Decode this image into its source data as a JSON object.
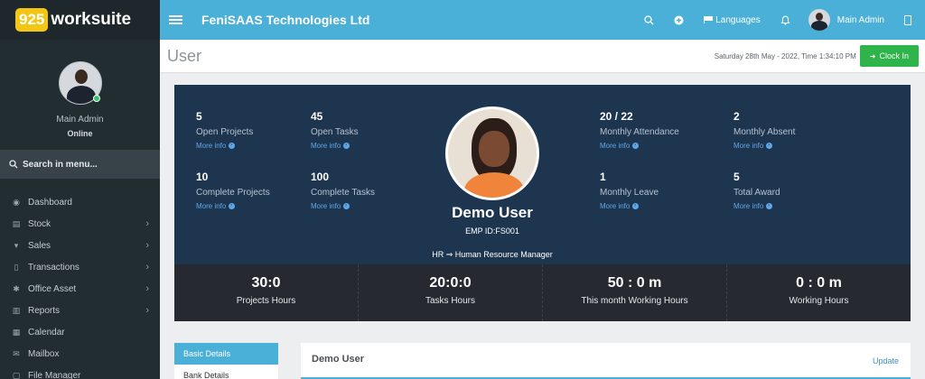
{
  "brand": {
    "badge": "925",
    "name": "worksuite"
  },
  "sidebar": {
    "profile_name": "Main Admin",
    "profile_status": "Online",
    "search_label": "Search in menu...",
    "items": [
      {
        "icon": "dashboard-icon",
        "label": "Dashboard",
        "chevron": false
      },
      {
        "icon": "stock-icon",
        "label": "Stock",
        "chevron": true
      },
      {
        "icon": "cart-icon",
        "label": "Sales",
        "chevron": true
      },
      {
        "icon": "transactions-icon",
        "label": "Transactions",
        "chevron": true
      },
      {
        "icon": "office-asset-icon",
        "label": "Office Asset",
        "chevron": true
      },
      {
        "icon": "reports-icon",
        "label": "Reports",
        "chevron": true
      },
      {
        "icon": "calendar-icon",
        "label": "Calendar",
        "chevron": false
      },
      {
        "icon": "mailbox-icon",
        "label": "Mailbox",
        "chevron": false
      },
      {
        "icon": "file-manager-icon",
        "label": "File Manager",
        "chevron": false
      }
    ]
  },
  "topbar": {
    "company": "FeniSAAS Technologies Ltd",
    "languages_label": "Languages",
    "user_name": "Main Admin"
  },
  "header": {
    "title": "User",
    "datetime": "Saturday 28th May - 2022,  Time   1:34:10 PM",
    "clock_in_label": "Clock In"
  },
  "hero": {
    "stats_left": [
      {
        "value": "5",
        "label": "Open Projects",
        "more": "More info"
      },
      {
        "value": "45",
        "label": "Open Tasks",
        "more": "More info"
      },
      {
        "value": "10",
        "label": "Complete Projects",
        "more": "More info"
      },
      {
        "value": "100",
        "label": "Complete Tasks",
        "more": "More info"
      }
    ],
    "stats_right": [
      {
        "value": "20 / 22",
        "label": "Monthly Attendance",
        "more": "More info"
      },
      {
        "value": "2",
        "label": "Monthly Absent",
        "more": "More info"
      },
      {
        "value": "1",
        "label": "Monthly Leave",
        "more": "More info"
      },
      {
        "value": "5",
        "label": "Total Award",
        "more": "More info"
      }
    ],
    "name": "Demo User",
    "emp_id": "EMP ID:FS001",
    "role": "HR ⇒ Human Resource Manager",
    "hours": [
      {
        "value": "30:0",
        "label": "Projects Hours"
      },
      {
        "value": "20:0:0",
        "label": "Tasks Hours"
      },
      {
        "value": "50 : 0 m",
        "label": "This month Working Hours"
      },
      {
        "value": "0 : 0 m",
        "label": "Working Hours"
      }
    ]
  },
  "tabs": [
    "Basic Details",
    "Bank Details"
  ],
  "card": {
    "title": "Demo User",
    "update_label": "Update"
  }
}
